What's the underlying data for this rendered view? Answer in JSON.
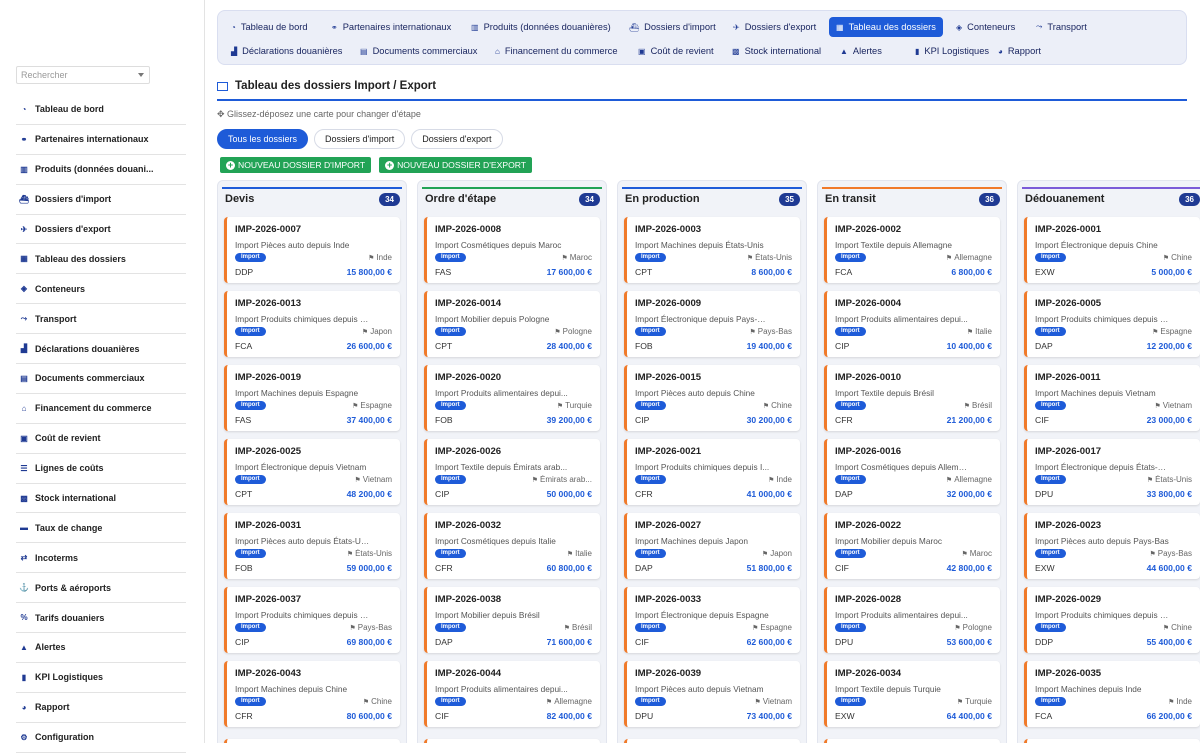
{
  "sidebar": {
    "search_placeholder": "Rechercher",
    "items": [
      {
        "label": "Tableau de bord",
        "icon": "dashboard-icon"
      },
      {
        "label": "Partenaires internationaux",
        "icon": "handshake-icon"
      },
      {
        "label": "Produits (données douani...",
        "icon": "barcode-icon"
      },
      {
        "label": "Dossiers d'import",
        "icon": "ship-icon"
      },
      {
        "label": "Dossiers d'export",
        "icon": "plane-icon"
      },
      {
        "label": "Tableau des dossiers",
        "icon": "columns-icon"
      },
      {
        "label": "Conteneurs",
        "icon": "cube-icon"
      },
      {
        "label": "Transport",
        "icon": "route-icon"
      },
      {
        "label": "Déclarations douanières",
        "icon": "stamp-icon"
      },
      {
        "label": "Documents commerciaux",
        "icon": "file-icon"
      },
      {
        "label": "Financement du commerce",
        "icon": "bank-icon"
      },
      {
        "label": "Coût de revient",
        "icon": "calculator-icon"
      },
      {
        "label": "Lignes de coûts",
        "icon": "list-icon"
      },
      {
        "label": "Stock international",
        "icon": "warehouse-icon"
      },
      {
        "label": "Taux de change",
        "icon": "money-icon"
      },
      {
        "label": "Incoterms",
        "icon": "exchange-icon"
      },
      {
        "label": "Ports & aéroports",
        "icon": "anchor-icon"
      },
      {
        "label": "Tarifs douaniers",
        "icon": "percent-icon"
      },
      {
        "label": "Alertes",
        "icon": "warning-icon"
      },
      {
        "label": "KPI Logistiques",
        "icon": "kpi-icon"
      },
      {
        "label": "Rapport",
        "icon": "report-icon"
      },
      {
        "label": "Configuration",
        "icon": "gear-icon"
      }
    ]
  },
  "nav_tabs": [
    {
      "label": "Tableau de bord",
      "icon": "dashboard-icon"
    },
    {
      "label": "Partenaires internationaux",
      "icon": "handshake-icon"
    },
    {
      "label": "Produits (données douanières)",
      "icon": "barcode-icon"
    },
    {
      "label": "Dossiers d'import",
      "icon": "ship-icon"
    },
    {
      "label": "Dossiers d'export",
      "icon": "plane-icon"
    },
    {
      "label": "Tableau des dossiers",
      "icon": "columns-icon",
      "active": true
    },
    {
      "label": "Conteneurs",
      "icon": "cube-icon"
    },
    {
      "label": "Transport",
      "icon": "route-icon"
    },
    {
      "label": "Déclarations douanières",
      "icon": "stamp-icon"
    },
    {
      "label": "Documents commerciaux",
      "icon": "file-icon"
    },
    {
      "label": "Financement du commerce",
      "icon": "bank-icon"
    },
    {
      "label": "Coût de revient",
      "icon": "calculator-icon"
    },
    {
      "label": "Stock international",
      "icon": "warehouse-icon"
    },
    {
      "label": "Alertes",
      "icon": "warning-icon"
    },
    {
      "label": "KPI Logistiques",
      "icon": "kpi-icon"
    },
    {
      "label": "Rapport",
      "icon": "report-icon"
    }
  ],
  "page": {
    "title": "Tableau des dossiers Import / Export",
    "hint": "Glissez-déposez une carte pour changer d'étape",
    "filters": [
      {
        "label": "Tous les dossiers",
        "active": true
      },
      {
        "label": "Dossiers d'import",
        "active": false
      },
      {
        "label": "Dossiers d'export",
        "active": false
      }
    ],
    "new_import_label": "NOUVEAU DOSSIER D'IMPORT",
    "new_export_label": "NOUVEAU DOSSIER D'EXPORT"
  },
  "colors": {
    "primary": "#1e5bd8",
    "green": "#22a356",
    "card_border": "#f07a2a",
    "badge_dark": "#1f3a93"
  },
  "columns": [
    {
      "title": "Devis",
      "count": "34",
      "accent": "#1e5bd8",
      "cards": [
        {
          "ref": "IMP-2026-0007",
          "desc": "Import Pièces auto depuis Inde",
          "badge": "Import",
          "country": "Inde",
          "incoterm": "DDP",
          "amount": "15 800,00 €"
        },
        {
          "ref": "IMP-2026-0013",
          "desc": "Import Produits chimiques depuis J...",
          "badge": "Import",
          "country": "Japon",
          "incoterm": "FCA",
          "amount": "26 600,00 €"
        },
        {
          "ref": "IMP-2026-0019",
          "desc": "Import Machines depuis Espagne",
          "badge": "Import",
          "country": "Espagne",
          "incoterm": "FAS",
          "amount": "37 400,00 €"
        },
        {
          "ref": "IMP-2026-0025",
          "desc": "Import Électronique depuis Vietnam",
          "badge": "Import",
          "country": "Vietnam",
          "incoterm": "CPT",
          "amount": "48 200,00 €"
        },
        {
          "ref": "IMP-2026-0031",
          "desc": "Import Pièces auto depuis États-Un...",
          "badge": "Import",
          "country": "États-Unis",
          "incoterm": "FOB",
          "amount": "59 000,00 €"
        },
        {
          "ref": "IMP-2026-0037",
          "desc": "Import Produits chimiques depuis P...",
          "badge": "Import",
          "country": "Pays-Bas",
          "incoterm": "CIP",
          "amount": "69 800,00 €"
        },
        {
          "ref": "IMP-2026-0043",
          "desc": "Import Machines depuis Chine",
          "badge": "Import",
          "country": "Chine",
          "incoterm": "CFR",
          "amount": "80 600,00 €"
        }
      ]
    },
    {
      "title": "Ordre d'étape",
      "count": "34",
      "accent": "#22a356",
      "cards": [
        {
          "ref": "IMP-2026-0008",
          "desc": "Import Cosmétiques depuis Maroc",
          "badge": "Import",
          "country": "Maroc",
          "incoterm": "FAS",
          "amount": "17 600,00 €"
        },
        {
          "ref": "IMP-2026-0014",
          "desc": "Import Mobilier depuis Pologne",
          "badge": "Import",
          "country": "Pologne",
          "incoterm": "CPT",
          "amount": "28 400,00 €"
        },
        {
          "ref": "IMP-2026-0020",
          "desc": "Import Produits alimentaires depui...",
          "badge": "Import",
          "country": "Turquie",
          "incoterm": "FOB",
          "amount": "39 200,00 €"
        },
        {
          "ref": "IMP-2026-0026",
          "desc": "Import Textile depuis Émirats arab...",
          "badge": "Import",
          "country": "Émirats arab...",
          "incoterm": "CIP",
          "amount": "50 000,00 €"
        },
        {
          "ref": "IMP-2026-0032",
          "desc": "Import Cosmétiques depuis Italie",
          "badge": "Import",
          "country": "Italie",
          "incoterm": "CFR",
          "amount": "60 800,00 €"
        },
        {
          "ref": "IMP-2026-0038",
          "desc": "Import Mobilier depuis Brésil",
          "badge": "Import",
          "country": "Brésil",
          "incoterm": "DAP",
          "amount": "71 600,00 €"
        },
        {
          "ref": "IMP-2026-0044",
          "desc": "Import Produits alimentaires depui...",
          "badge": "Import",
          "country": "Allemagne",
          "incoterm": "CIF",
          "amount": "82 400,00 €"
        }
      ]
    },
    {
      "title": "En production",
      "count": "35",
      "accent": "#1e5bd8",
      "cards": [
        {
          "ref": "IMP-2026-0003",
          "desc": "Import Machines depuis États-Unis",
          "badge": "Import",
          "country": "États-Unis",
          "incoterm": "CPT",
          "amount": "8 600,00 €"
        },
        {
          "ref": "IMP-2026-0009",
          "desc": "Import Électronique depuis Pays-Bas",
          "badge": "Import",
          "country": "Pays-Bas",
          "incoterm": "FOB",
          "amount": "19 400,00 €"
        },
        {
          "ref": "IMP-2026-0015",
          "desc": "Import Pièces auto depuis Chine",
          "badge": "Import",
          "country": "Chine",
          "incoterm": "CIP",
          "amount": "30 200,00 €"
        },
        {
          "ref": "IMP-2026-0021",
          "desc": "Import Produits chimiques depuis I...",
          "badge": "Import",
          "country": "Inde",
          "incoterm": "CFR",
          "amount": "41 000,00 €"
        },
        {
          "ref": "IMP-2026-0027",
          "desc": "Import Machines depuis Japon",
          "badge": "Import",
          "country": "Japon",
          "incoterm": "DAP",
          "amount": "51 800,00 €"
        },
        {
          "ref": "IMP-2026-0033",
          "desc": "Import Électronique depuis Espagne",
          "badge": "Import",
          "country": "Espagne",
          "incoterm": "CIF",
          "amount": "62 600,00 €"
        },
        {
          "ref": "IMP-2026-0039",
          "desc": "Import Pièces auto depuis Vietnam",
          "badge": "Import",
          "country": "Vietnam",
          "incoterm": "DPU",
          "amount": "73 400,00 €"
        }
      ]
    },
    {
      "title": "En transit",
      "count": "36",
      "accent": "#f07a2a",
      "cards": [
        {
          "ref": "IMP-2026-0002",
          "desc": "Import Textile depuis Allemagne",
          "badge": "Import",
          "country": "Allemagne",
          "incoterm": "FCA",
          "amount": "6 800,00 €"
        },
        {
          "ref": "IMP-2026-0004",
          "desc": "Import Produits alimentaires depui...",
          "badge": "Import",
          "country": "Italie",
          "incoterm": "CIP",
          "amount": "10 400,00 €"
        },
        {
          "ref": "IMP-2026-0010",
          "desc": "Import Textile depuis Brésil",
          "badge": "Import",
          "country": "Brésil",
          "incoterm": "CFR",
          "amount": "21 200,00 €"
        },
        {
          "ref": "IMP-2026-0016",
          "desc": "Import Cosmétiques depuis Allemagne",
          "badge": "Import",
          "country": "Allemagne",
          "incoterm": "DAP",
          "amount": "32 000,00 €"
        },
        {
          "ref": "IMP-2026-0022",
          "desc": "Import Mobilier depuis Maroc",
          "badge": "Import",
          "country": "Maroc",
          "incoterm": "CIF",
          "amount": "42 800,00 €"
        },
        {
          "ref": "IMP-2026-0028",
          "desc": "Import Produits alimentaires depui...",
          "badge": "Import",
          "country": "Pologne",
          "incoterm": "DPU",
          "amount": "53 600,00 €"
        },
        {
          "ref": "IMP-2026-0034",
          "desc": "Import Textile depuis Turquie",
          "badge": "Import",
          "country": "Turquie",
          "incoterm": "EXW",
          "amount": "64 400,00 €"
        }
      ]
    },
    {
      "title": "Dédouanement",
      "count": "36",
      "accent": "#7b5bd8",
      "cards": [
        {
          "ref": "IMP-2026-0001",
          "desc": "Import Électronique depuis Chine",
          "badge": "Import",
          "country": "Chine",
          "incoterm": "EXW",
          "amount": "5 000,00 €"
        },
        {
          "ref": "IMP-2026-0005",
          "desc": "Import Produits chimiques depuis E...",
          "badge": "Import",
          "country": "Espagne",
          "incoterm": "DAP",
          "amount": "12 200,00 €"
        },
        {
          "ref": "IMP-2026-0011",
          "desc": "Import Machines depuis Vietnam",
          "badge": "Import",
          "country": "Vietnam",
          "incoterm": "CIF",
          "amount": "23 000,00 €"
        },
        {
          "ref": "IMP-2026-0017",
          "desc": "Import Électronique depuis États-U...",
          "badge": "Import",
          "country": "États-Unis",
          "incoterm": "DPU",
          "amount": "33 800,00 €"
        },
        {
          "ref": "IMP-2026-0023",
          "desc": "Import Pièces auto depuis Pays-Bas",
          "badge": "Import",
          "country": "Pays-Bas",
          "incoterm": "EXW",
          "amount": "44 600,00 €"
        },
        {
          "ref": "IMP-2026-0029",
          "desc": "Import Produits chimiques depuis C...",
          "badge": "Import",
          "country": "Chine",
          "incoterm": "DDP",
          "amount": "55 400,00 €"
        },
        {
          "ref": "IMP-2026-0035",
          "desc": "Import Machines depuis Inde",
          "badge": "Import",
          "country": "Inde",
          "incoterm": "FCA",
          "amount": "66 200,00 €"
        }
      ]
    }
  ]
}
